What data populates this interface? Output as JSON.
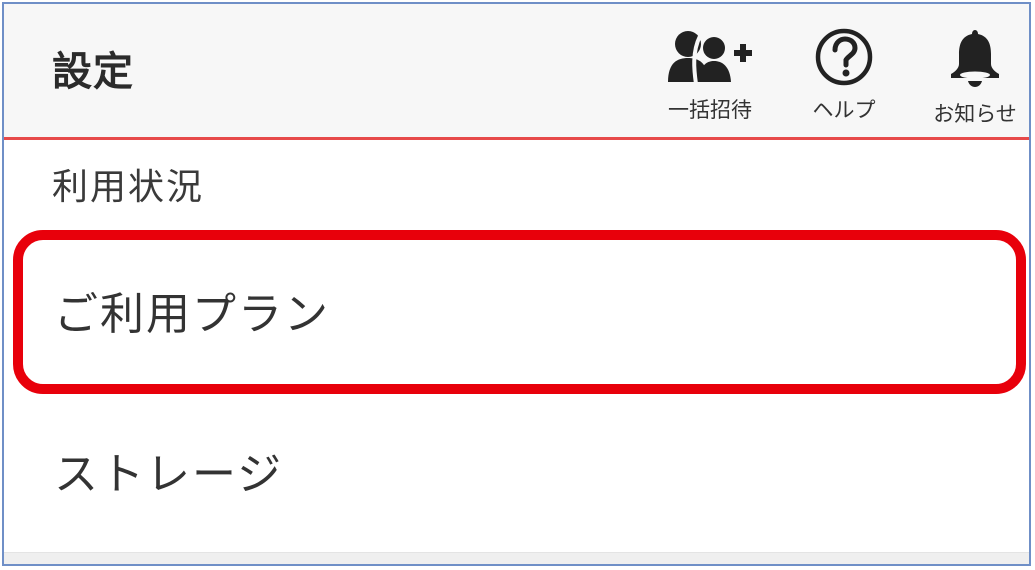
{
  "header": {
    "title": "設定",
    "buttons": {
      "invite": {
        "label": "一括招待",
        "icon": "add-users-icon"
      },
      "help": {
        "label": "ヘルプ",
        "icon": "question-circle-icon"
      },
      "notice": {
        "label": "お知らせ",
        "icon": "bell-icon"
      }
    },
    "accent_color": "#e74a4a"
  },
  "section": {
    "label": "利用状況"
  },
  "menu": {
    "items": [
      {
        "label": "ご利用プラン",
        "highlighted": true
      },
      {
        "label": "ストレージ",
        "highlighted": false
      }
    ]
  },
  "annotation": {
    "highlight_color": "#e8000b"
  }
}
